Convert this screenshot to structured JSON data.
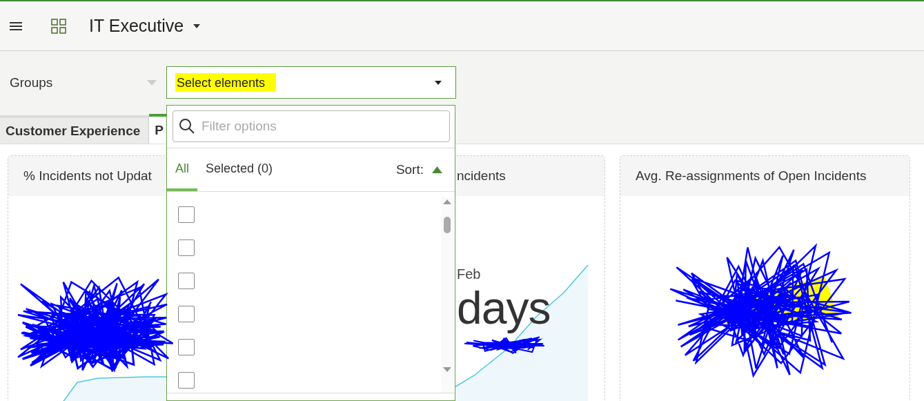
{
  "header": {
    "title": "IT Executive"
  },
  "filter": {
    "label": "Groups",
    "select": {
      "value": "Select elements",
      "highlighted": true
    }
  },
  "tabs": [
    {
      "label": "Customer Experience",
      "selected": false
    },
    {
      "label": "P",
      "selected": true
    }
  ],
  "cards": [
    {
      "title": "% Incidents not Updat"
    },
    {
      "title": "ncidents",
      "date": "Feb",
      "value": "days"
    },
    {
      "title": "Avg. Re-assignments of Open Incidents"
    }
  ],
  "dropdown": {
    "search_placeholder": "Filter options",
    "tabs": [
      {
        "label": "All",
        "selected": true
      },
      {
        "label": "Selected (0)",
        "selected": false
      }
    ],
    "sort_label": "Sort:",
    "sort_ascending": true,
    "options": [
      {
        "checked": false
      },
      {
        "checked": false
      },
      {
        "checked": false
      },
      {
        "checked": false
      },
      {
        "checked": false
      },
      {
        "checked": false
      }
    ]
  }
}
